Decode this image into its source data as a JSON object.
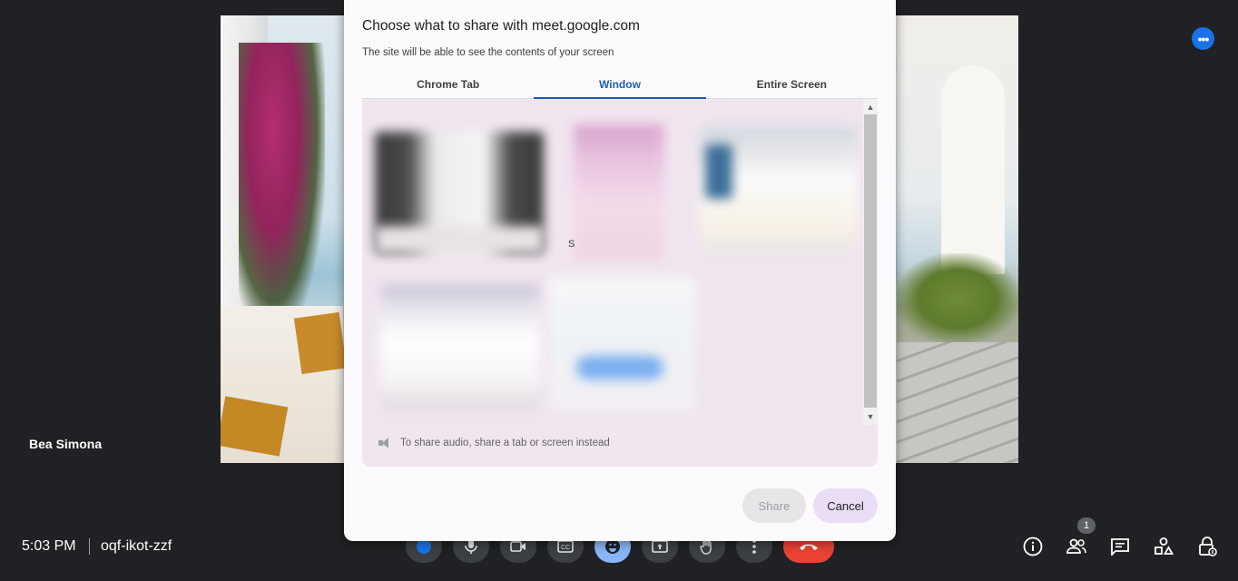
{
  "video": {
    "participant_name": "Bea Simona"
  },
  "meeting": {
    "time": "5:03 PM",
    "code": "oqf-ikot-zzf"
  },
  "controls": {
    "people_count": "1"
  },
  "dialog": {
    "title": "Choose what to share with meet.google.com",
    "subtitle": "The site will be able to see the contents of your screen",
    "tabs": [
      {
        "label": "Chrome Tab",
        "active": false
      },
      {
        "label": "Window",
        "active": true
      },
      {
        "label": "Entire Screen",
        "active": false
      }
    ],
    "thumbnail_text": "S",
    "audio_note": "To share audio, share a tab or screen instead",
    "share_label": "Share",
    "cancel_label": "Cancel"
  },
  "icons": {
    "more": "more-horiz-icon",
    "mic": "mic-icon",
    "camera": "videocam-icon",
    "captions": "captions-icon",
    "emoji": "emoji-icon",
    "present": "present-icon",
    "hand": "raise-hand-icon",
    "options": "more-vert-icon",
    "end": "call-end-icon",
    "info": "info-icon",
    "people": "people-icon",
    "chat": "chat-icon",
    "activities": "activities-icon",
    "host": "host-controls-icon",
    "speaker": "speaker-icon"
  },
  "colors": {
    "accent_blue": "#1a73e8",
    "tab_active": "#1a5fb4",
    "end_call": "#ea4335",
    "dialog_panel": "#f1e6f0",
    "cancel_button": "#eaddf6"
  }
}
